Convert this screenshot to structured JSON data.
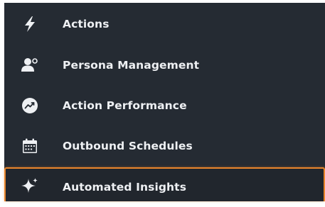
{
  "menu": {
    "items": [
      {
        "label": "Actions",
        "icon": "lightning-bolt-icon"
      },
      {
        "label": "Persona Management",
        "icon": "persona-icon"
      },
      {
        "label": "Action Performance",
        "icon": "trend-chart-icon"
      },
      {
        "label": "Outbound Schedules",
        "icon": "calendar-icon"
      },
      {
        "label": "Automated Insights",
        "icon": "sparkle-icon"
      }
    ],
    "active_index": 4
  },
  "colors": {
    "background": "#252b33",
    "text": "#eef0f3",
    "active_border": "#e8852c"
  }
}
